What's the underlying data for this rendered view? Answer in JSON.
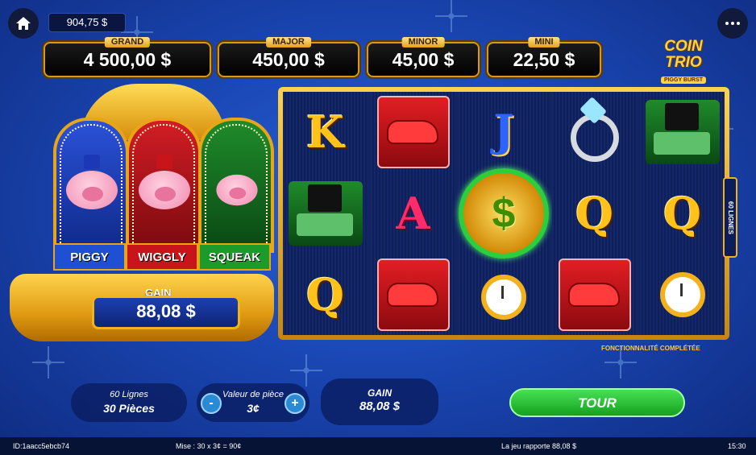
{
  "balance": "904,75 $",
  "jackpots": [
    {
      "label": "GRAND",
      "value": "4 500,00 $"
    },
    {
      "label": "MAJOR",
      "value": "450,00 $"
    },
    {
      "label": "MINOR",
      "value": "45,00 $"
    },
    {
      "label": "MINI",
      "value": "22,50 $"
    }
  ],
  "logo": {
    "title": "COIN TRIO",
    "subtitle": "PIGGY BURST"
  },
  "pigs": [
    "PIGGY",
    "WIGGLY",
    "SQUEAK"
  ],
  "machine_gain": {
    "label": "GAIN",
    "value": "88,08 $"
  },
  "reels": {
    "col1": [
      "K",
      "hat-money",
      "Q"
    ],
    "col2": [
      "red-car",
      "A",
      "red-car"
    ],
    "col3": [
      "J",
      "dollar-coin",
      "watch"
    ],
    "col4": [
      "diamond-ring",
      "Q",
      "red-car"
    ],
    "col5": [
      "hat-money",
      "Q",
      "watch"
    ],
    "lines_tag": "60 LIGNES",
    "feature_text": "FONCTIONNALITÉ COMPLÉTÉE"
  },
  "bottom": {
    "lines": "60 Lignes",
    "coins": "30 Pièces",
    "coin_value_label": "Valeur de pièce",
    "coin_value": "3¢",
    "minus": "-",
    "plus": "+",
    "gain_label": "GAIN",
    "gain_value": "88,08 $",
    "spin_label": "TOUR"
  },
  "status": {
    "id": "ID:1aacc5ebcb74",
    "bet": "Mise : 30 x 3¢ = 90¢",
    "win_text": "La jeu rapporte 88,08 $",
    "time": "15:30"
  }
}
